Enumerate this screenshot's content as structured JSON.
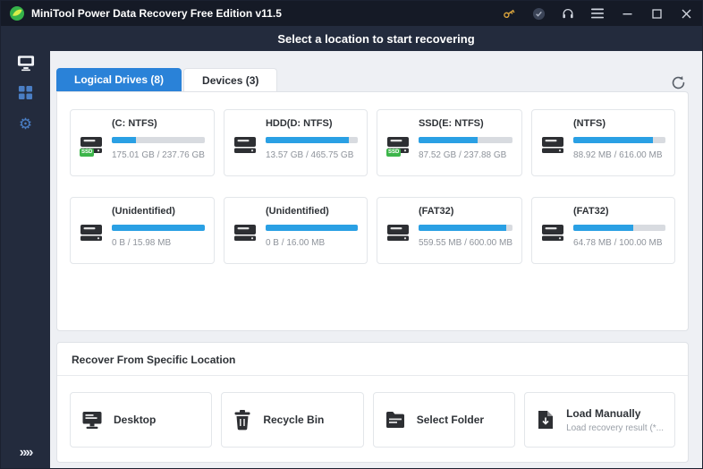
{
  "window": {
    "title": "MiniTool Power Data Recovery Free Edition v11.5",
    "subtitle": "Select a location to start recovering"
  },
  "tabs": [
    {
      "label": "Logical Drives (8)",
      "active": true
    },
    {
      "label": "Devices (3)",
      "active": false
    }
  ],
  "drives": [
    {
      "name": "(C: NTFS)",
      "size": "175.01 GB / 237.76 GB",
      "percent": 26,
      "badge": "SSD"
    },
    {
      "name": "HDD(D: NTFS)",
      "size": "13.57 GB / 465.75 GB",
      "percent": 90
    },
    {
      "name": "SSD(E: NTFS)",
      "size": "87.52 GB / 237.88 GB",
      "percent": 63,
      "badge": "SSD"
    },
    {
      "name": "(NTFS)",
      "size": "88.92 MB / 616.00 MB",
      "percent": 86
    },
    {
      "name": "(Unidentified)",
      "size": "0 B / 15.98 MB",
      "percent": 100
    },
    {
      "name": "(Unidentified)",
      "size": "0 B / 16.00 MB",
      "percent": 100
    },
    {
      "name": "(FAT32)",
      "size": "559.55 MB / 600.00 MB",
      "percent": 93
    },
    {
      "name": "(FAT32)",
      "size": "64.78 MB / 100.00 MB",
      "percent": 65
    }
  ],
  "specific": {
    "title": "Recover From Specific Location",
    "items": [
      {
        "label": "Desktop"
      },
      {
        "label": "Recycle Bin"
      },
      {
        "label": "Select Folder"
      },
      {
        "label": "Load Manually",
        "sub": "Load recovery result (*..."
      }
    ]
  },
  "colors": {
    "accent_blue": "#2a82d8",
    "bar_blue": "#2aa0e4",
    "ssd_green": "#3cb54a",
    "key_gold": "#d9a33c",
    "titlebar": "#151a26",
    "sidebar": "#232b3d"
  }
}
